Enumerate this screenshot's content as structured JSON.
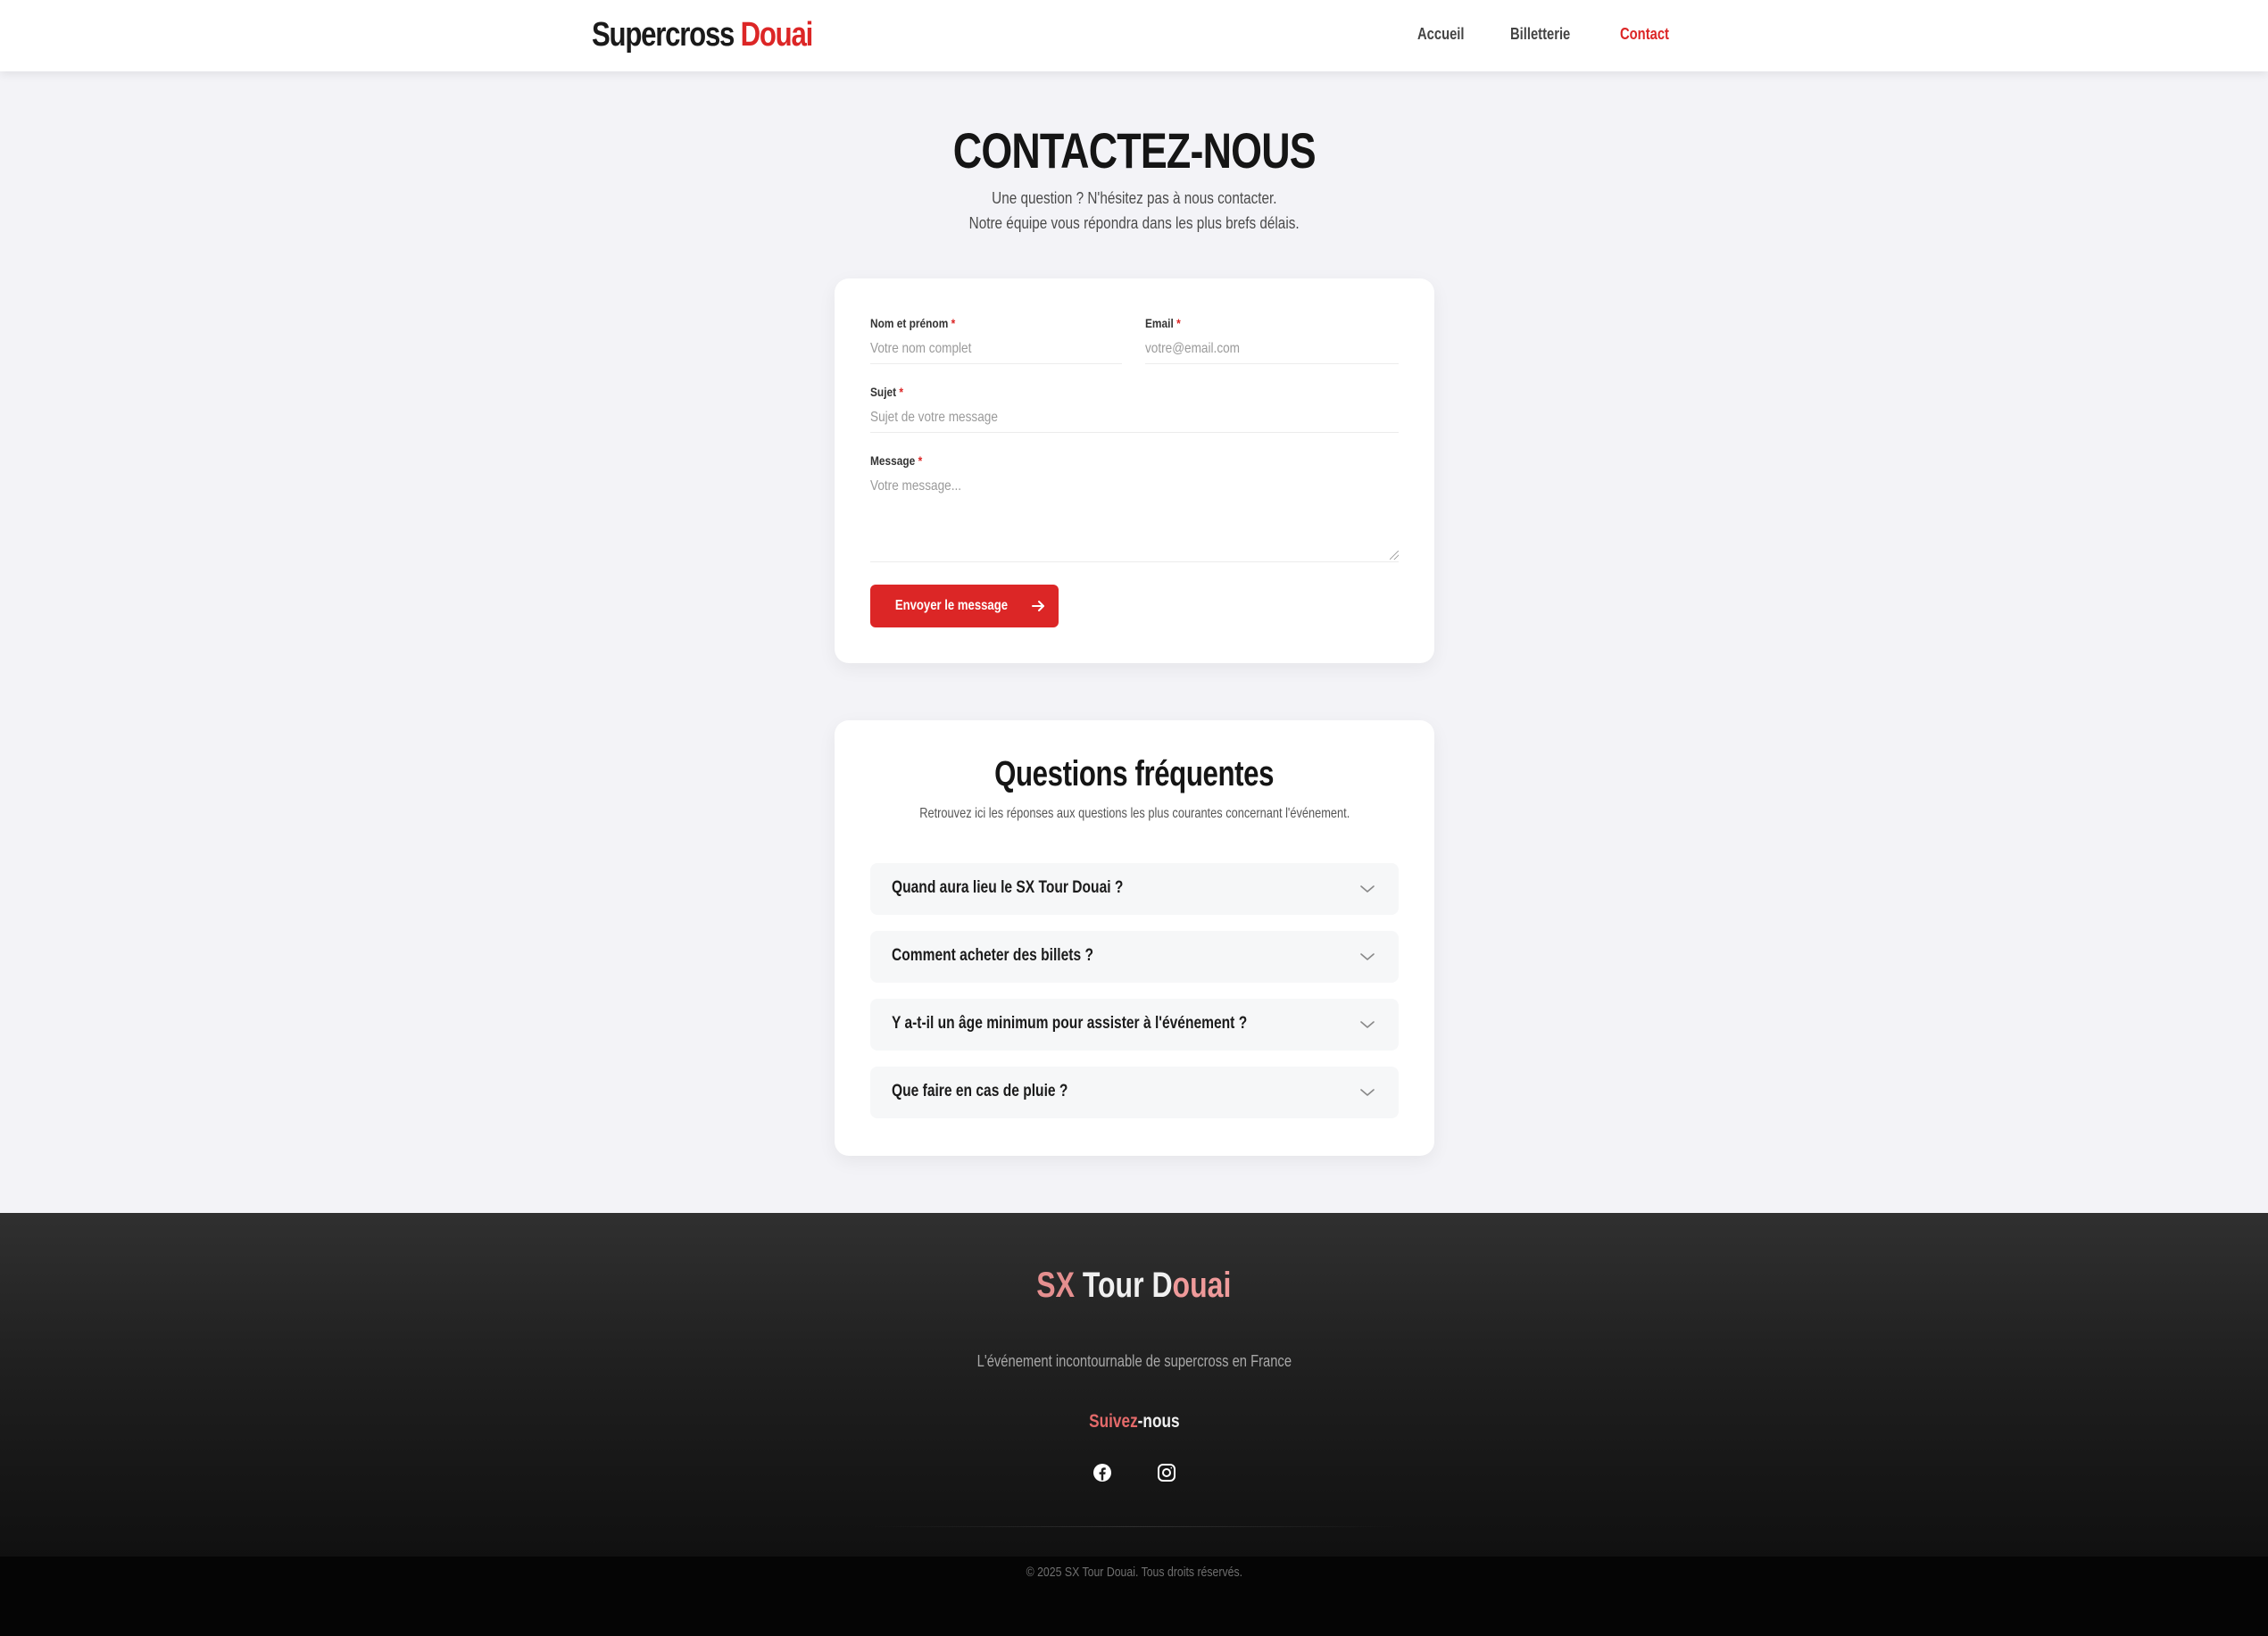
{
  "nav": {
    "logo_main": "Supercross ",
    "logo_accent": "Douai",
    "links": [
      {
        "label": "Accueil",
        "active": false
      },
      {
        "label": "Billetterie",
        "active": false
      },
      {
        "label": "Contact",
        "active": true
      }
    ]
  },
  "hero": {
    "title": "CONTACTEZ-NOUS",
    "sub_line1": "Une question ? N'hésitez pas à nous contacter.",
    "sub_line2": "Notre équipe vous répondra dans les plus brefs délais."
  },
  "form": {
    "name_label": "Nom et prénom",
    "name_placeholder": "Votre nom complet",
    "email_label": "Email",
    "email_placeholder": "votre@email.com",
    "subject_label": "Sujet",
    "subject_placeholder": "Sujet de votre message",
    "message_label": "Message",
    "message_placeholder": "Votre message...",
    "required_mark": "*",
    "submit_label": "Envoyer le message",
    "submit_icon": "arrow-right-icon"
  },
  "faq": {
    "title": "Questions fréquentes",
    "subtitle": "Retrouvez ici les réponses aux questions les plus courantes concernant l'événement.",
    "items": [
      {
        "question": "Quand aura lieu le SX Tour Douai ?"
      },
      {
        "question": "Comment acheter des billets ?"
      },
      {
        "question": "Y a-t-il un âge minimum pour assister à l'événement ?"
      },
      {
        "question": "Que faire en cas de pluie ?"
      }
    ]
  },
  "footer": {
    "brand_sx": "SX",
    "brand_tour": " Tour D",
    "brand_douai": "ouai",
    "tagline": "L'événement incontournable de supercross en France",
    "follow_a": "Suivez",
    "follow_b": "-nous",
    "social_icons": [
      "facebook-icon",
      "instagram-icon"
    ],
    "copyright": "© 2025 SX Tour Douai. Tous droits réservés."
  },
  "colors": {
    "accent": "#dc2626",
    "background": "#f3f3f7",
    "card": "#ffffff",
    "footer": "#1e1e1e"
  }
}
